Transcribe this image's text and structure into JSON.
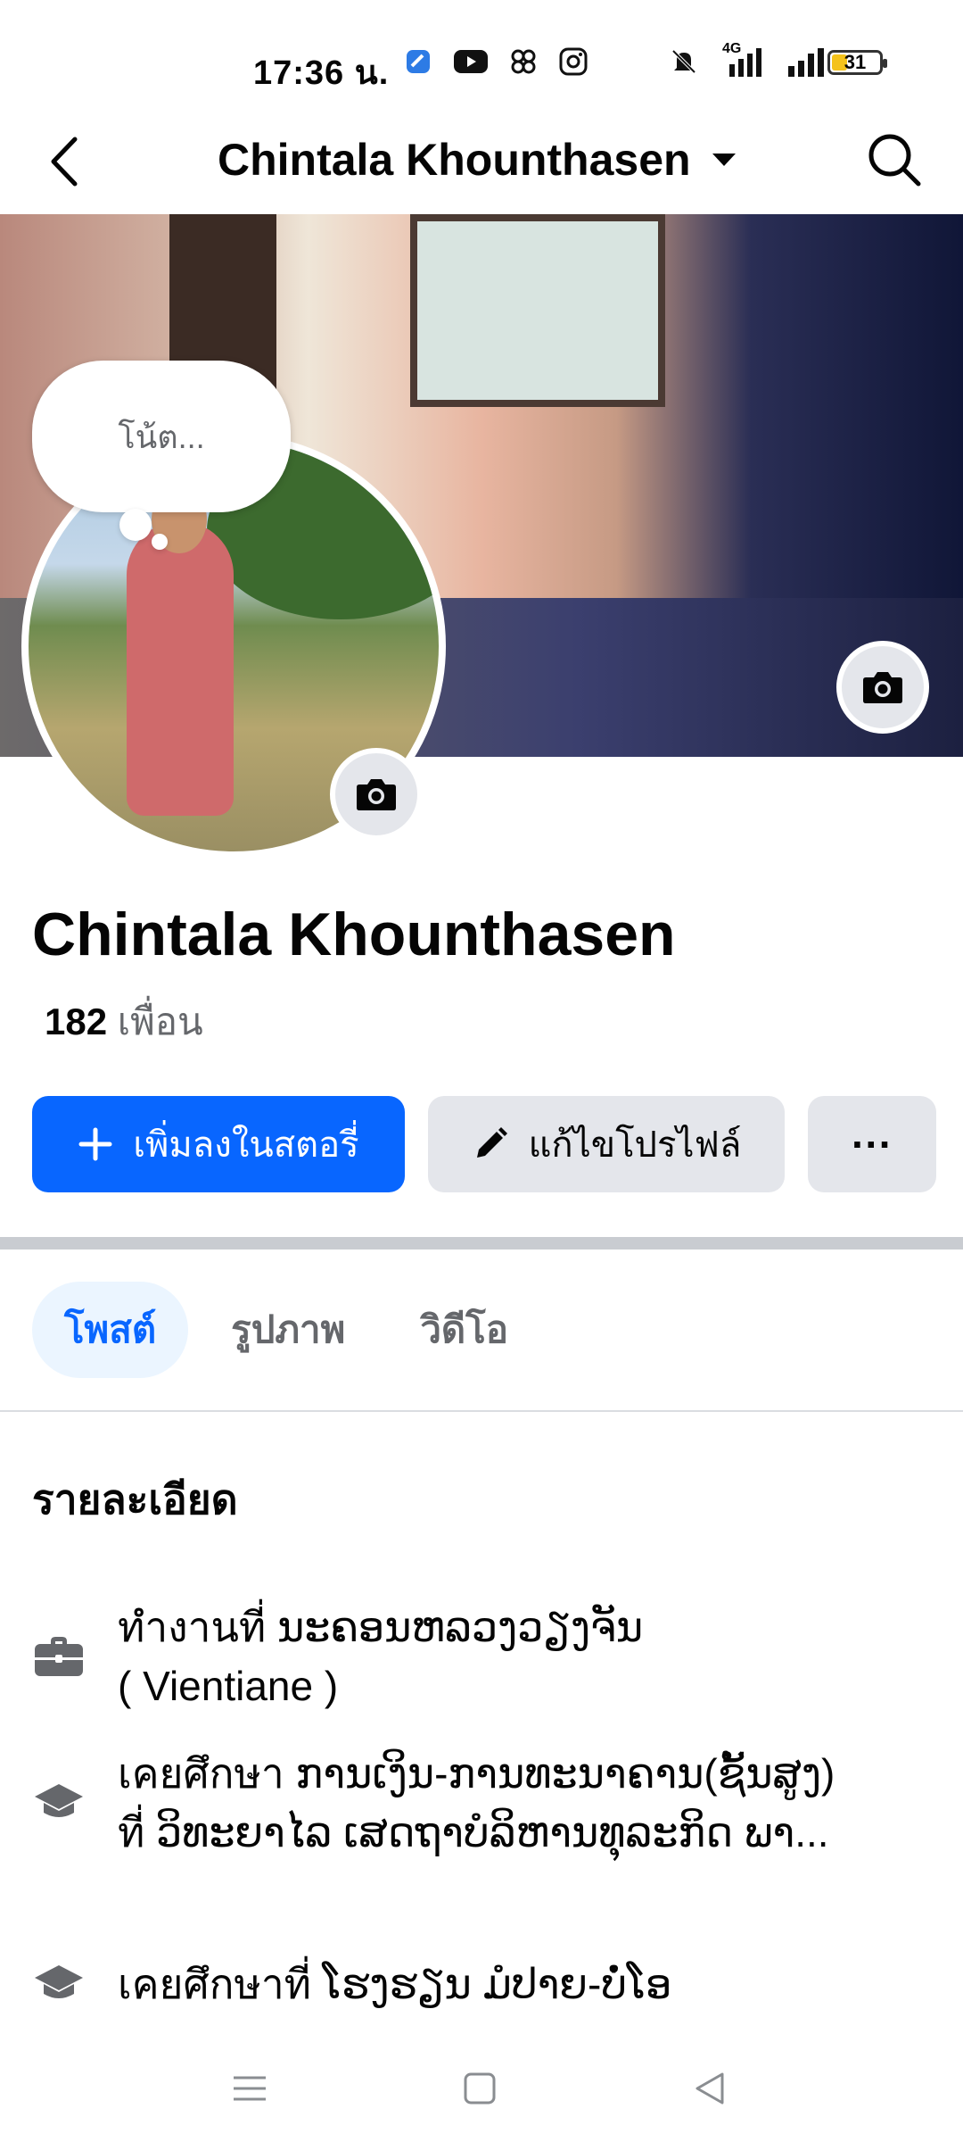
{
  "status_bar": {
    "time": "17:36 น.",
    "network": "4G",
    "battery": "31",
    "icons": [
      "app-icon",
      "youtube-icon",
      "app-icon",
      "instagram-icon",
      "mute-icon",
      "signal-icon",
      "signal-icon",
      "battery-icon"
    ]
  },
  "header": {
    "title": "Chintala Khounthasen",
    "icons": [
      "back-arrow-icon",
      "chevron-down-icon",
      "search-icon"
    ]
  },
  "note": {
    "placeholder": "โน้ต..."
  },
  "profile": {
    "name": "Chintala Khounthasen",
    "friends_count": "182",
    "friends_label": "เพื่อน"
  },
  "actions": {
    "add_story": "เพิ่มลงในสตอรี่",
    "edit_profile": "แก้ไขโปรไฟล์",
    "more": "···"
  },
  "tabs": [
    {
      "label": "โพสต์",
      "active": true
    },
    {
      "label": "รูปภาพ",
      "active": false
    },
    {
      "label": "วิดีโอ",
      "active": false
    }
  ],
  "details": {
    "title": "รายละเอียด",
    "items": [
      {
        "icon": "briefcase-icon",
        "line1": "ทำงานที่ ນະຄອນຫລວງວຽງຈັນ",
        "line2": "( Vientiane )"
      },
      {
        "icon": "graduation-cap-icon",
        "line1": "เคยศึกษา ການເງິນ-ການທະນາຄານ(ຊັ້ນສູງ)",
        "line2": "ที่ ວິທະຍາໄລ ເສດຖາບໍລິຫານທຸລະກິດ ພາ..."
      },
      {
        "icon": "graduation-cap-icon",
        "line1": "เคยศึกษาที่ ໂຮງຮຽນ ມໍປາຍ-ບໍ່ໂອ",
        "line2": ""
      }
    ]
  },
  "colors": {
    "primary": "#0866ff",
    "secondary_button": "#e4e6eb",
    "active_tab_bg": "#ebf5ff",
    "muted_text": "#65676b"
  }
}
